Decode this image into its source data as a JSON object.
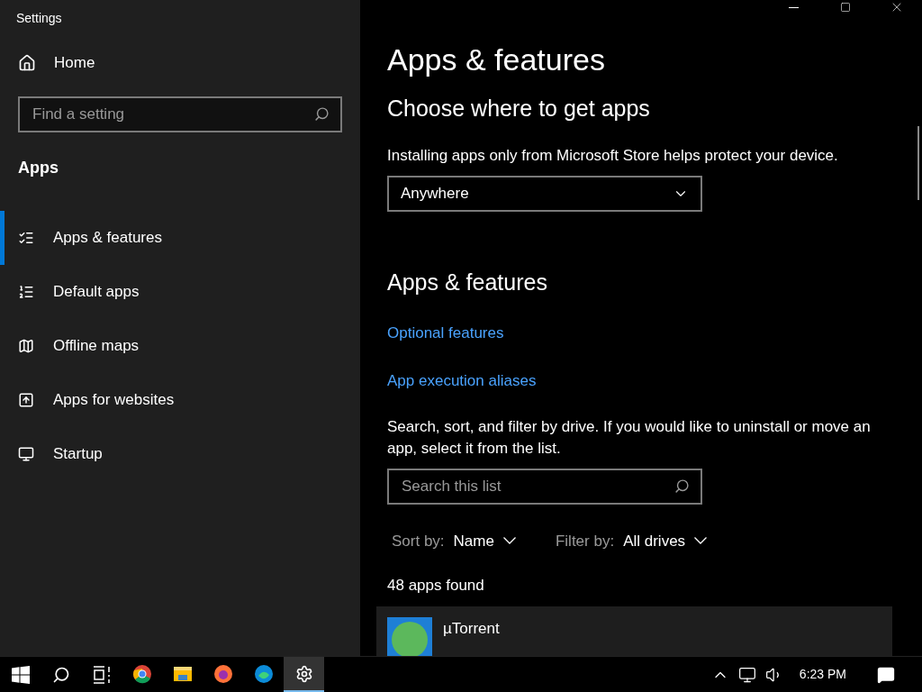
{
  "window": {
    "title": "Settings"
  },
  "sidebar": {
    "home": "Home",
    "search": {
      "placeholder": "Find a setting"
    },
    "section": "Apps",
    "items": [
      {
        "label": "Apps & features",
        "selected": true
      },
      {
        "label": "Default apps",
        "selected": false
      },
      {
        "label": "Offline maps",
        "selected": false
      },
      {
        "label": "Apps for websites",
        "selected": false
      },
      {
        "label": "Startup",
        "selected": false
      }
    ]
  },
  "main": {
    "title": "Apps & features",
    "source": {
      "heading": "Choose where to get apps",
      "description": "Installing apps only from Microsoft Store helps protect your device.",
      "dropdown": "Anywhere"
    },
    "features": {
      "heading": "Apps & features",
      "links": [
        "Optional features",
        "App execution aliases"
      ],
      "description": "Search, sort, and filter by drive. If you would like to uninstall or move an app, select it from the list.",
      "search": {
        "placeholder": "Search this list"
      },
      "sort": {
        "label": "Sort by:",
        "value": "Name"
      },
      "filter": {
        "label": "Filter by:",
        "value": "All drives"
      },
      "count": "48 apps found",
      "apps": [
        {
          "name": "µTorrent"
        }
      ]
    }
  },
  "taskbar": {
    "pinned": [
      {
        "selected": false
      },
      {
        "selected": false
      },
      {
        "selected": false
      },
      {
        "selected": false
      },
      {
        "selected": true
      }
    ],
    "time": "6:23 PM"
  }
}
